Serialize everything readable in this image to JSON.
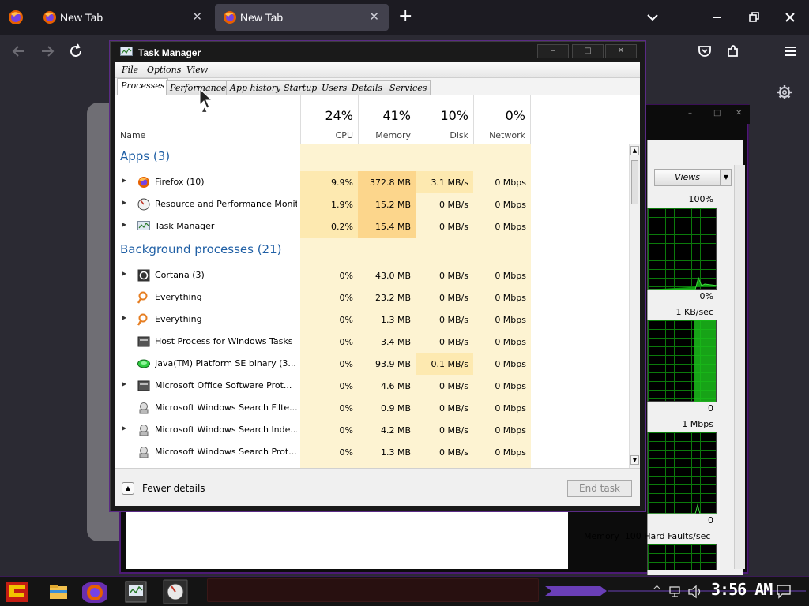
{
  "browser": {
    "tabs": [
      {
        "title": "New Tab"
      },
      {
        "title": "New Tab"
      }
    ],
    "new_tab_glyph": "+",
    "close_glyph": "✕"
  },
  "task_manager": {
    "title": "Task Manager",
    "menu": [
      "File",
      "Options",
      "View"
    ],
    "tabs": [
      "Processes",
      "Performance",
      "App history",
      "Startup",
      "Users",
      "Details",
      "Services"
    ],
    "active_tab": "Processes",
    "columns": {
      "name": "Name",
      "cpu": {
        "pct": "24%",
        "label": "CPU"
      },
      "memory": {
        "pct": "41%",
        "label": "Memory"
      },
      "disk": {
        "pct": "10%",
        "label": "Disk"
      },
      "network": {
        "pct": "0%",
        "label": "Network"
      }
    },
    "groups": {
      "apps": "Apps (3)",
      "background": "Background processes (21)"
    },
    "apps": [
      {
        "name": "Firefox (10)",
        "cpu": "9.9%",
        "memory": "372.8 MB",
        "disk": "3.1 MB/s",
        "network": "0 Mbps",
        "icon": "firefox-icon",
        "expandable": true
      },
      {
        "name": "Resource and Performance Monit...",
        "cpu": "1.9%",
        "memory": "15.2 MB",
        "disk": "0 MB/s",
        "network": "0 Mbps",
        "icon": "resource-monitor-icon",
        "expandable": true
      },
      {
        "name": "Task Manager",
        "cpu": "0.2%",
        "memory": "15.4 MB",
        "disk": "0 MB/s",
        "network": "0 Mbps",
        "icon": "task-manager-icon",
        "expandable": true
      }
    ],
    "background": [
      {
        "name": "Cortana (3)",
        "cpu": "0%",
        "memory": "43.0 MB",
        "disk": "0 MB/s",
        "network": "0 Mbps",
        "icon": "cortana-icon",
        "expandable": true
      },
      {
        "name": "Everything",
        "cpu": "0%",
        "memory": "23.2 MB",
        "disk": "0 MB/s",
        "network": "0 Mbps",
        "icon": "everything-search-icon",
        "expandable": false
      },
      {
        "name": "Everything",
        "cpu": "0%",
        "memory": "1.3 MB",
        "disk": "0 MB/s",
        "network": "0 Mbps",
        "icon": "everything-search-icon",
        "expandable": true
      },
      {
        "name": "Host Process for Windows Tasks",
        "cpu": "0%",
        "memory": "3.4 MB",
        "disk": "0 MB/s",
        "network": "0 Mbps",
        "icon": "host-process-icon",
        "expandable": false
      },
      {
        "name": "Java(TM) Platform SE binary (3...",
        "cpu": "0%",
        "memory": "93.9 MB",
        "disk": "0.1 MB/s",
        "network": "0 Mbps",
        "icon": "java-icon",
        "expandable": false
      },
      {
        "name": "Microsoft Office Software Prot...",
        "cpu": "0%",
        "memory": "4.6 MB",
        "disk": "0 MB/s",
        "network": "0 Mbps",
        "icon": "host-process-icon",
        "expandable": true
      },
      {
        "name": "Microsoft Windows Search Filte...",
        "cpu": "0%",
        "memory": "0.9 MB",
        "disk": "0 MB/s",
        "network": "0 Mbps",
        "icon": "search-indexer-icon",
        "expandable": false
      },
      {
        "name": "Microsoft Windows Search Inde...",
        "cpu": "0%",
        "memory": "4.2 MB",
        "disk": "0 MB/s",
        "network": "0 Mbps",
        "icon": "search-indexer-icon",
        "expandable": true
      },
      {
        "name": "Microsoft Windows Search Prot...",
        "cpu": "0%",
        "memory": "1.3 MB",
        "disk": "0 MB/s",
        "network": "0 Mbps",
        "icon": "search-indexer-icon",
        "expandable": false
      }
    ],
    "footer": {
      "fewer_details": "Fewer details",
      "end_task": "End task"
    }
  },
  "resource_monitor": {
    "views_label": "Views",
    "labels": [
      "100%",
      "0%",
      "1 KB/sec",
      "0",
      "1 Mbps",
      "0"
    ],
    "memory_label": "Memory",
    "hard_faults": "100 Hard Faults/sec"
  },
  "taskbar": {
    "clock": "3:56 AM"
  },
  "colors": {
    "group_heading": "#1f5fa5",
    "cpu_heat": "#fde9b0",
    "memory_heat": "#fcd68c",
    "graph_green": "#0b7a0b",
    "accent_purple": "#7a2fc0"
  }
}
